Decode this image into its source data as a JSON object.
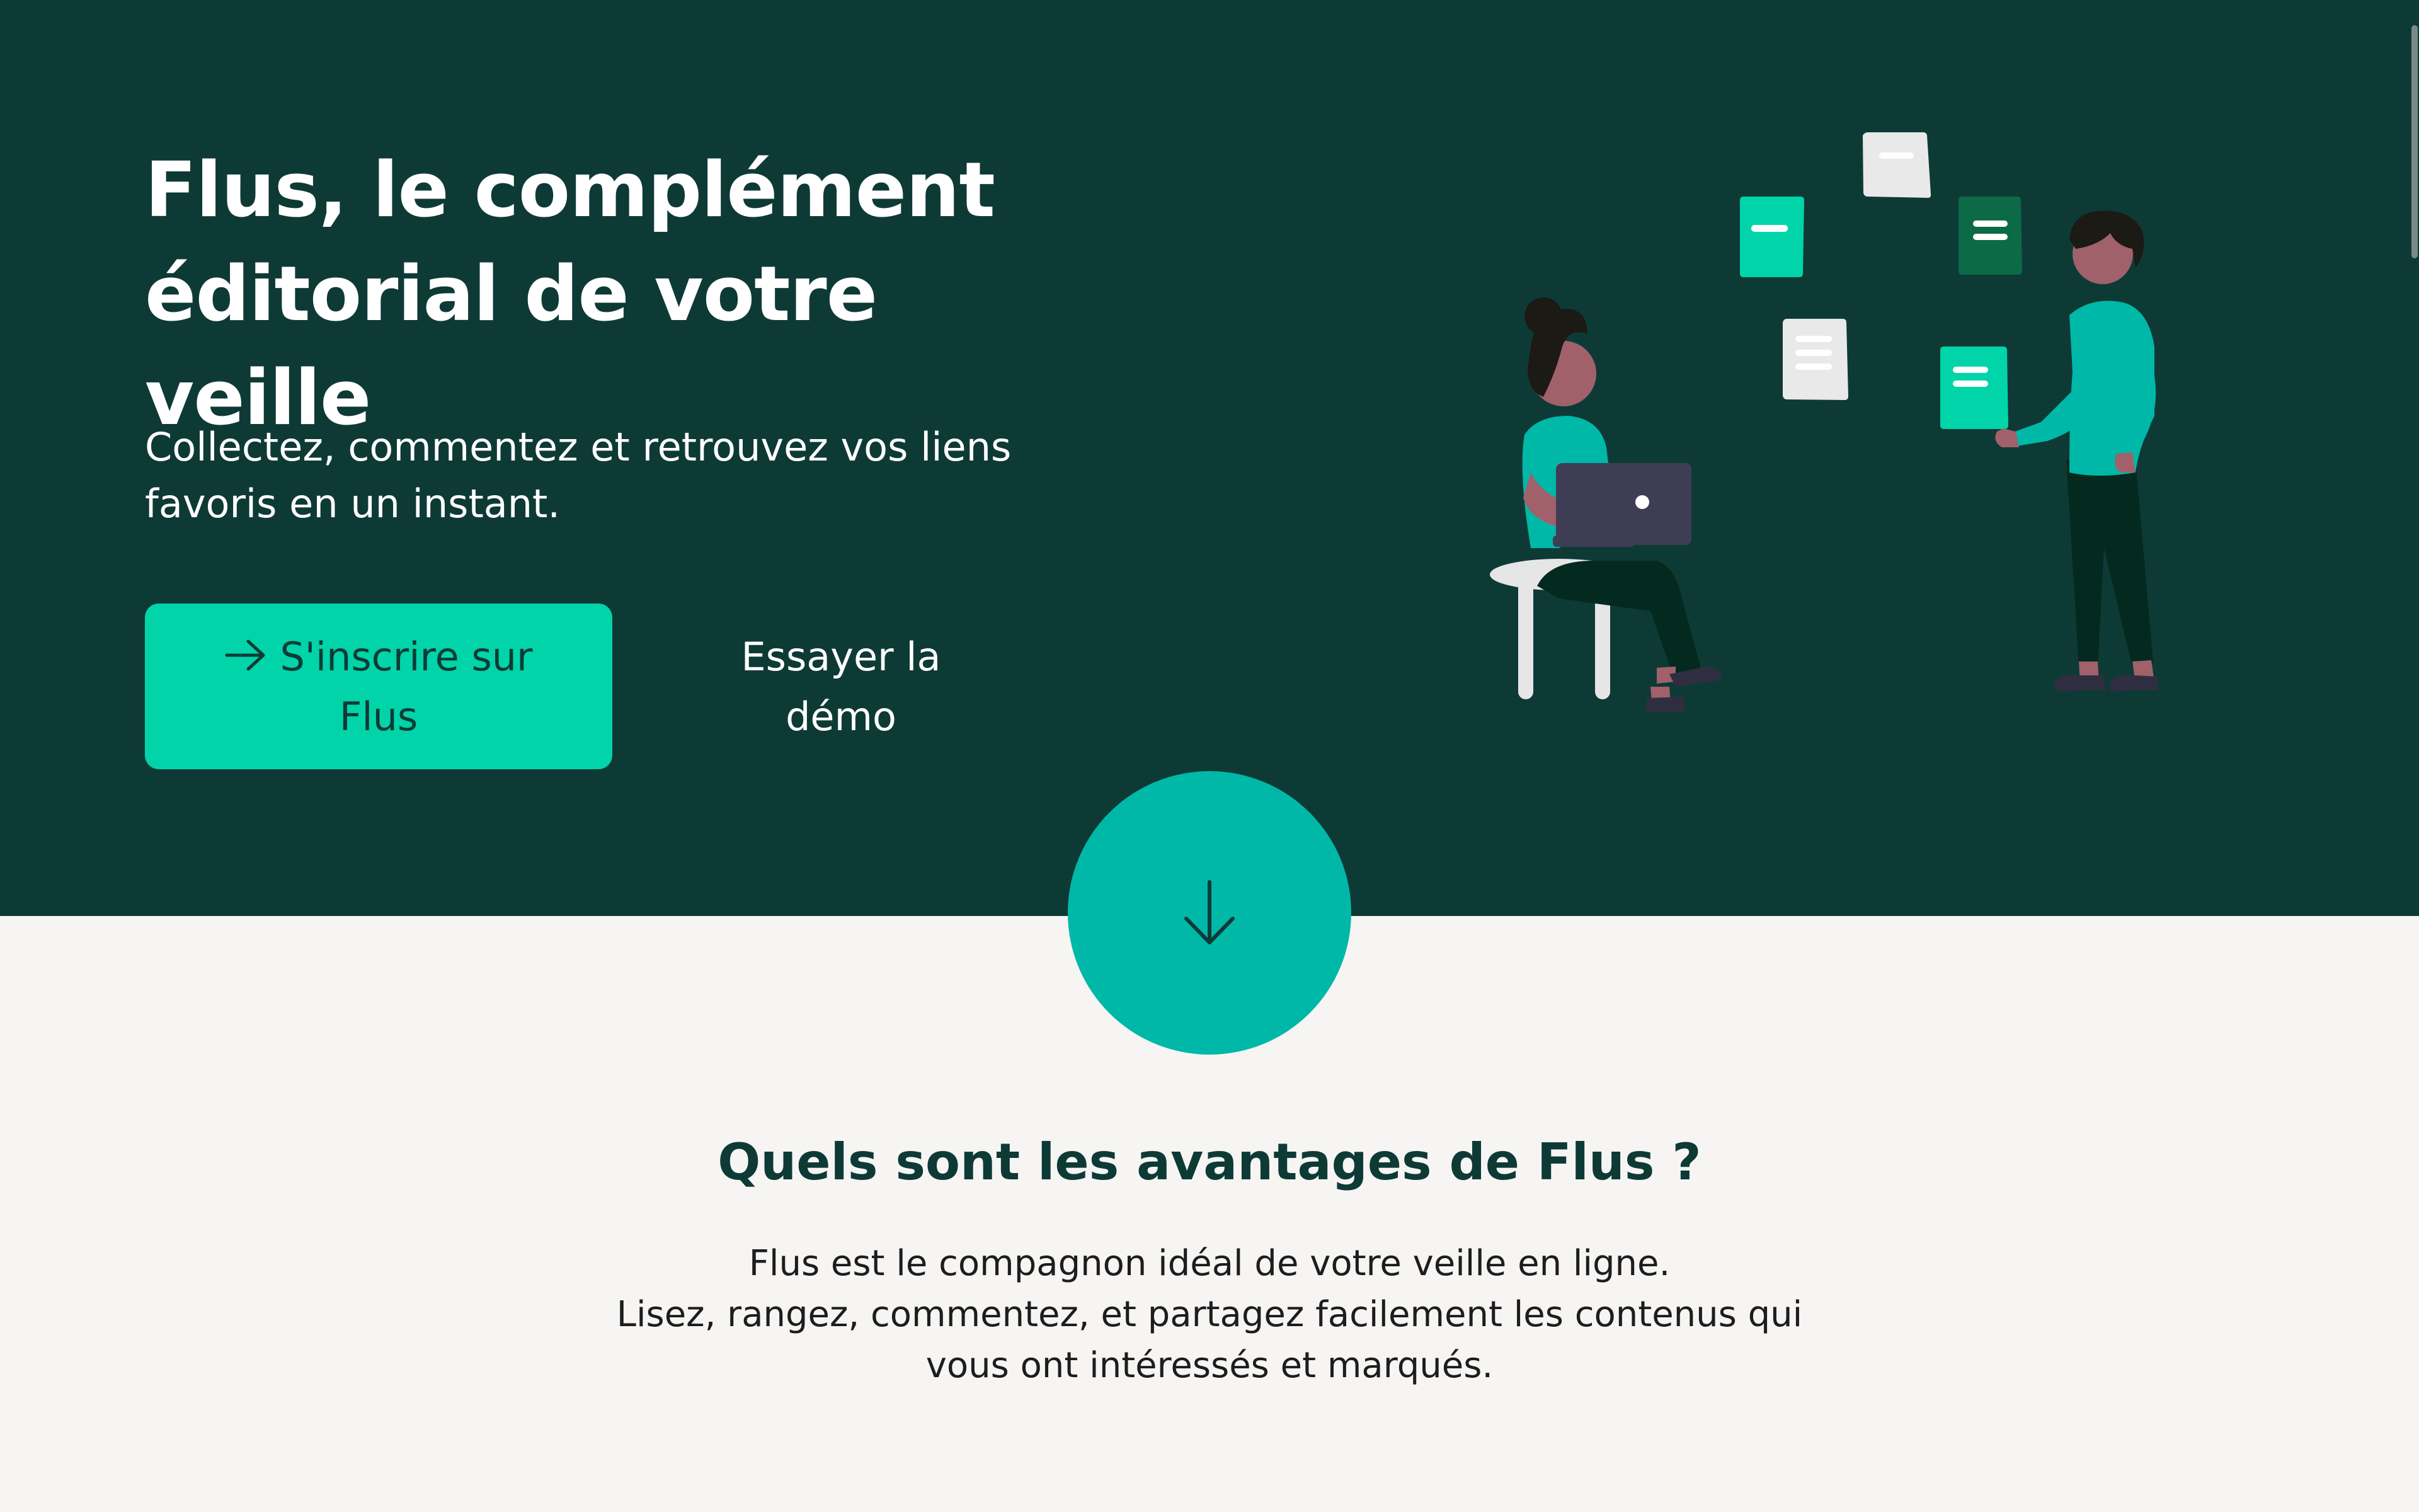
{
  "hero": {
    "title": "Flus, le complément éditorial de votre veille",
    "subtitle": "Collectez, commentez et retrouvez vos liens favoris en un instant.",
    "primary_button": {
      "icon": "arrow-right-icon",
      "label": "S'inscrire sur Flus"
    },
    "secondary_button": {
      "label": "Essayer la démo"
    }
  },
  "scroll_button": {
    "icon": "arrow-down-icon"
  },
  "advantages": {
    "title": "Quels sont les avantages de Flus ?",
    "lines": [
      "Flus est le compagnon idéal de votre veille en ligne.",
      "Lisez, rangez, commentez, et partagez facilement les contenus qui vous ont intéressés et marqués."
    ]
  },
  "colors": {
    "hero_background": "#0e3a36",
    "primary_accent": "#00d4a8",
    "circle_accent": "#00b8a8",
    "page_background": "#f6f5f3",
    "heading_text": "#0e3a36"
  }
}
